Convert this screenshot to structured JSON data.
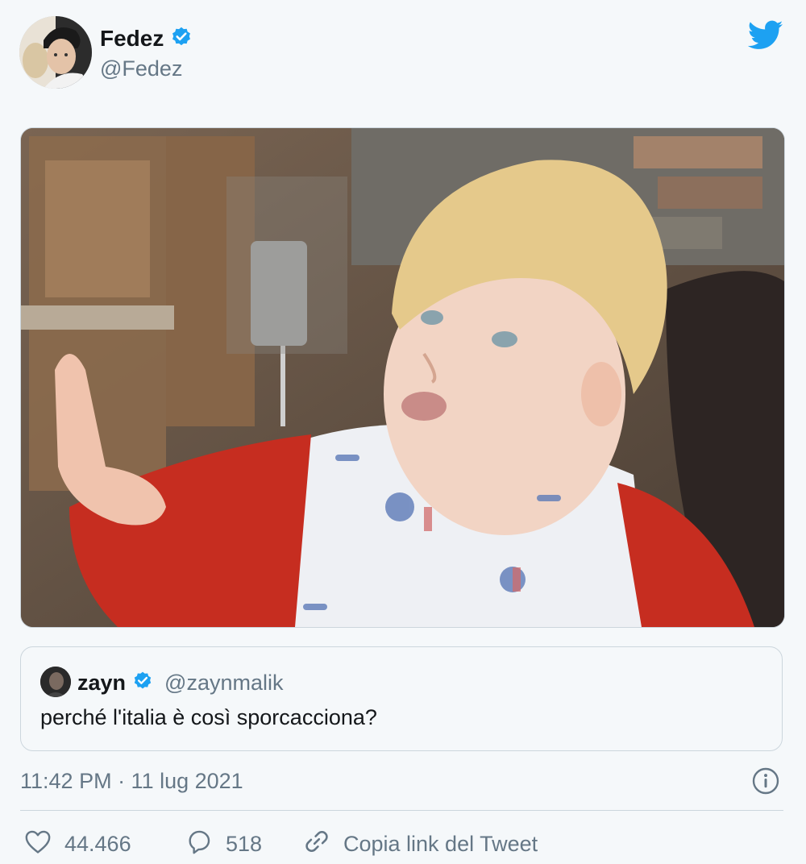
{
  "author": {
    "name": "Fedez",
    "handle": "@Fedez",
    "verified_color": "#1da1f2"
  },
  "brand": {
    "logo": "twitter-bird-icon",
    "color": "#1da1f2"
  },
  "media": {
    "kind": "photo",
    "subject": "toddler-raising-hand"
  },
  "quote": {
    "name": "zayn",
    "handle": "@zaynmalik",
    "text": "perché l'italia è così sporcacciona?"
  },
  "timestamp": "11:42 PM · 11 lug 2021",
  "actions": {
    "likes": "44.466",
    "replies": "518",
    "copy_link": "Copia link del Tweet"
  }
}
